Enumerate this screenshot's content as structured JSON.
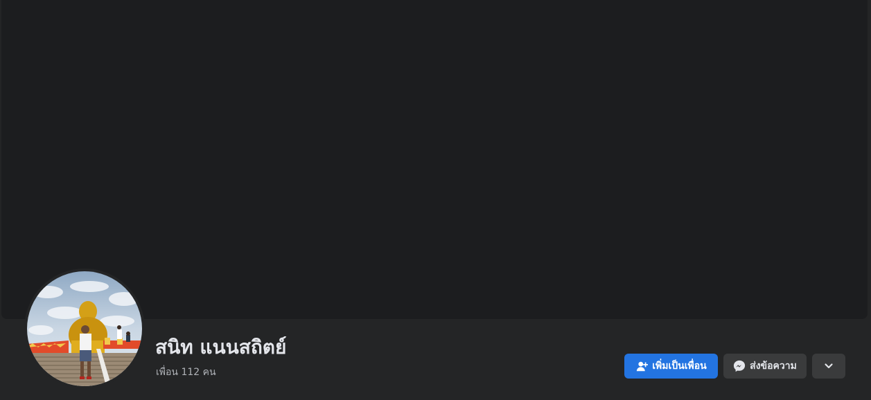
{
  "profile": {
    "name": "สนิท แนนสถิตย์",
    "friends_count": "เพื่อน 112 คน"
  },
  "actions": {
    "add_friend_label": "เพิ่มเป็นเพื่อน",
    "message_label": "ส่งข้อความ",
    "more_icon": "chevron-down-icon",
    "add_friend_icon": "person-add-icon",
    "message_icon": "messenger-icon"
  },
  "colors": {
    "background": "#242526",
    "cover": "#1c1d1f",
    "primary_button": "#2374e1",
    "secondary_button": "#3a3b3c",
    "text_primary": "#e4e6eb",
    "text_secondary": "#b0b3b8"
  }
}
